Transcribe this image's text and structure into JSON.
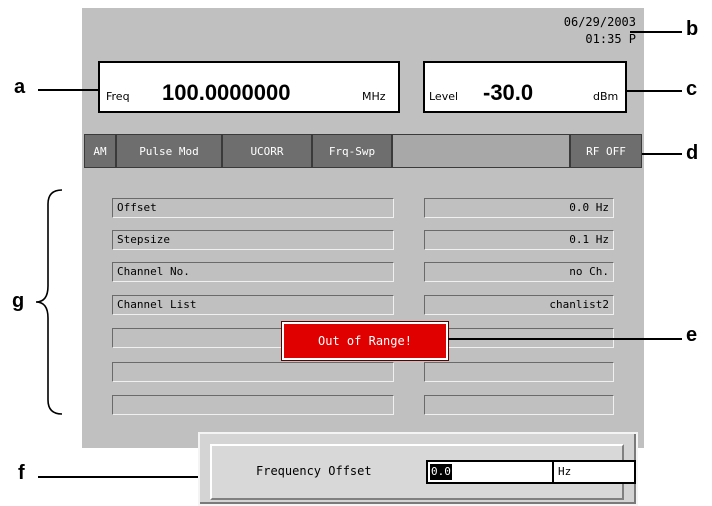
{
  "status": {
    "date": "06/29/2003",
    "time": "01:35 P"
  },
  "freq_display": {
    "label": "Freq",
    "value": "100.0000000",
    "unit": "MHz"
  },
  "level_display": {
    "label": "Level",
    "value": "-30.0",
    "unit": "dBm"
  },
  "softkeys": {
    "am": "AM",
    "pulse_mod": "Pulse Mod",
    "ucorr": "UCORR",
    "frq_swp": "Frq-Swp",
    "rf_off": "RF OFF"
  },
  "params": [
    {
      "label": "Offset",
      "value": "0.0 Hz"
    },
    {
      "label": "Stepsize",
      "value": "0.1 Hz"
    },
    {
      "label": "Channel No.",
      "value": "no Ch."
    },
    {
      "label": "Channel List",
      "value": "chanlist2"
    },
    {
      "label": "",
      "value": ""
    },
    {
      "label": "",
      "value": ""
    },
    {
      "label": "",
      "value": ""
    }
  ],
  "popup": {
    "message": "Out of Range!"
  },
  "entry_dialog": {
    "label": "Frequency Offset",
    "value": "0.0",
    "unit": "Hz"
  },
  "annotations": {
    "a": "a",
    "b": "b",
    "c": "c",
    "d": "d",
    "e": "e",
    "f": "f",
    "g": "g"
  },
  "colors": {
    "screen": "#c0c0c0",
    "softkey": "#6e6e6e",
    "popup": "#e00000"
  }
}
